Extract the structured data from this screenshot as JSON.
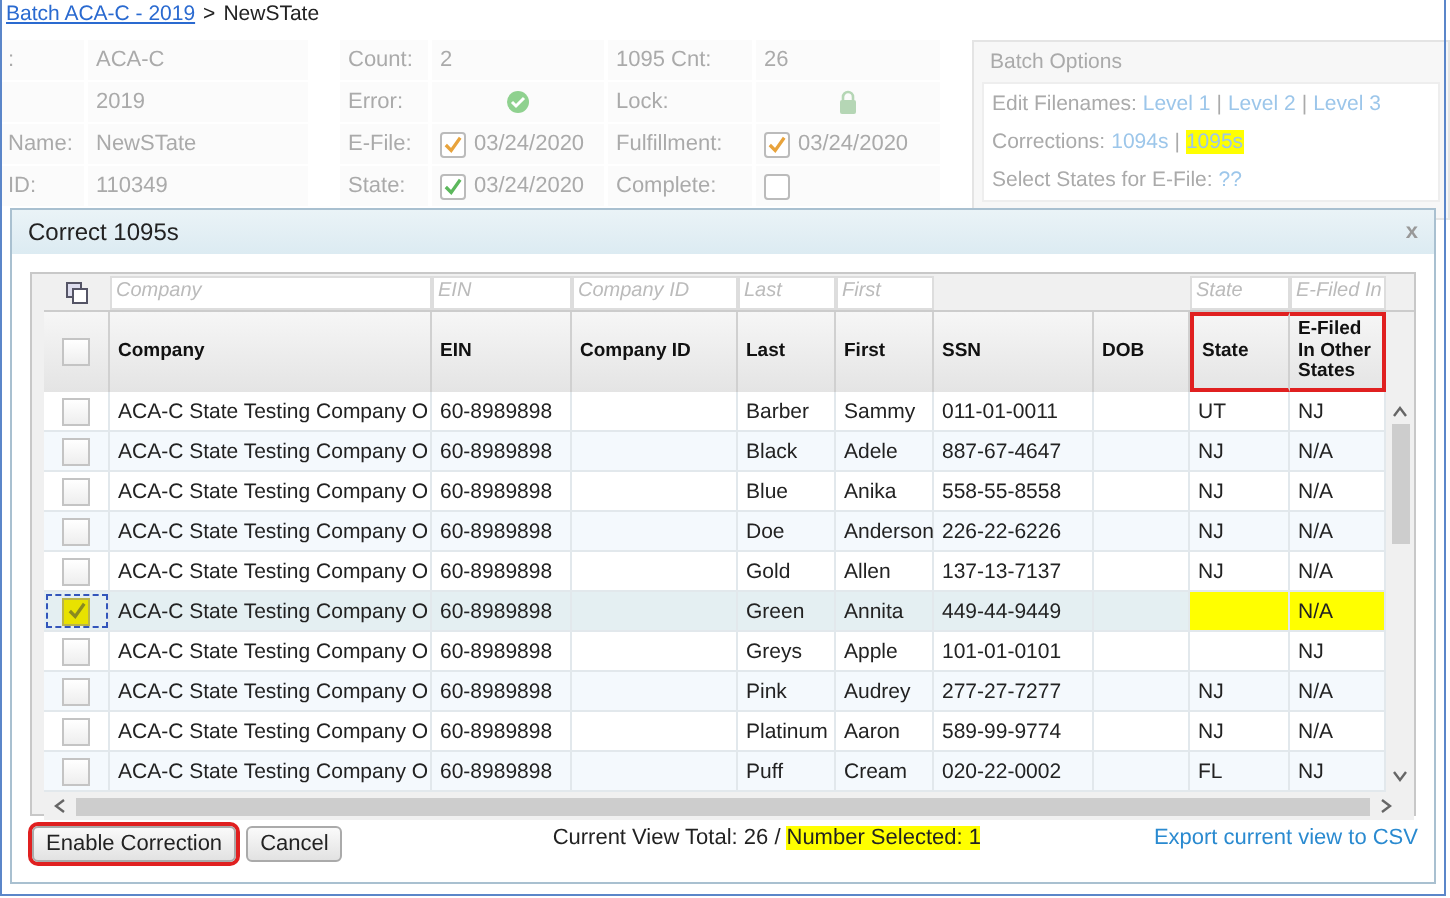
{
  "breadcrumb": {
    "link": "Batch ACA-C - 2019",
    "separator": ">",
    "current": "NewSTate"
  },
  "batch_info": {
    "fields": [
      {
        "label": ":",
        "value": "ACA-C"
      },
      {
        "value": "2019"
      },
      {
        "label": "Name:",
        "value": "NewSTate"
      },
      {
        "label": "ID:",
        "value": "110349"
      }
    ],
    "status": [
      {
        "label": "Count:",
        "kind": "text",
        "value": "2"
      },
      {
        "label": "1095 Cnt:",
        "kind": "text",
        "value": "26"
      },
      {
        "label": "Error:",
        "kind": "ok"
      },
      {
        "label": "Lock:",
        "kind": "lock"
      },
      {
        "label": "E-File:",
        "kind": "check",
        "checked": true,
        "color": "#e8a33c",
        "value": "03/24/2020"
      },
      {
        "label": "Fulfillment:",
        "kind": "check",
        "checked": true,
        "color": "#e8a33c",
        "value": "03/24/2020"
      },
      {
        "label": "State:",
        "kind": "check",
        "checked": true,
        "color": "#5cb85c",
        "value": "03/24/2020"
      },
      {
        "label": "Complete:",
        "kind": "check",
        "checked": false
      }
    ]
  },
  "batch_options": {
    "title": "Batch Options",
    "lines": [
      {
        "label": "Edit Filenames:",
        "separator": "|",
        "links": [
          {
            "text": "Level 1",
            "highlighted": false
          },
          {
            "text": "Level 2",
            "highlighted": false
          },
          {
            "text": "Level 3",
            "highlighted": false
          }
        ]
      },
      {
        "label": "Corrections:",
        "separator": "|",
        "links": [
          {
            "text": "1094s",
            "highlighted": false
          },
          {
            "text": "1095s",
            "highlighted": true
          }
        ]
      },
      {
        "label": "Select States for E-File:",
        "links": [
          {
            "text": "??",
            "highlighted": false
          }
        ]
      }
    ]
  },
  "dialog": {
    "title": "Correct 1095s",
    "close": "x",
    "table": {
      "select_all": {
        "checked": false
      },
      "columns": [
        {
          "label": "Company",
          "filter": "Company",
          "outlined": false
        },
        {
          "label": "EIN",
          "filter": "EIN",
          "outlined": false
        },
        {
          "label": "Company ID",
          "filter": "Company ID",
          "outlined": false
        },
        {
          "label": "Last",
          "filter": "Last",
          "outlined": false
        },
        {
          "label": "First",
          "filter": "First",
          "outlined": false
        },
        {
          "label": "SSN",
          "outlined": false
        },
        {
          "label": "DOB",
          "outlined": false
        },
        {
          "label": "State",
          "filter": "State",
          "outlined": true
        },
        {
          "label": "E-Filed In Other States",
          "filter": "E-Filed In",
          "outlined": true
        }
      ],
      "rows": [
        {
          "selected": false,
          "highlighted": false,
          "cells": [
            "ACA-C State Testing Company O",
            "60-8989898",
            "",
            "Barber",
            "Sammy",
            "011-01-0011",
            "",
            "UT",
            "NJ"
          ]
        },
        {
          "selected": false,
          "highlighted": false,
          "cells": [
            "ACA-C State Testing Company O",
            "60-8989898",
            "",
            "Black",
            "Adele",
            "887-67-4647",
            "",
            "NJ",
            "N/A"
          ]
        },
        {
          "selected": false,
          "highlighted": false,
          "cells": [
            "ACA-C State Testing Company O",
            "60-8989898",
            "",
            "Blue",
            "Anika",
            "558-55-8558",
            "",
            "NJ",
            "N/A"
          ]
        },
        {
          "selected": false,
          "highlighted": false,
          "cells": [
            "ACA-C State Testing Company O",
            "60-8989898",
            "",
            "Doe",
            "Anderson",
            "226-22-6226",
            "",
            "NJ",
            "N/A"
          ]
        },
        {
          "selected": false,
          "highlighted": false,
          "cells": [
            "ACA-C State Testing Company O",
            "60-8989898",
            "",
            "Gold",
            "Allen",
            "137-13-7137",
            "",
            "NJ",
            "N/A"
          ]
        },
        {
          "selected": true,
          "highlighted": true,
          "cells": [
            "ACA-C State Testing Company O",
            "60-8989898",
            "",
            "Green",
            "Annita",
            "449-44-9449",
            "",
            "",
            "N/A"
          ]
        },
        {
          "selected": false,
          "highlighted": false,
          "cells": [
            "ACA-C State Testing Company O",
            "60-8989898",
            "",
            "Greys",
            "Apple",
            "101-01-0101",
            "",
            "",
            "NJ"
          ]
        },
        {
          "selected": false,
          "highlighted": false,
          "cells": [
            "ACA-C State Testing Company O",
            "60-8989898",
            "",
            "Pink",
            "Audrey",
            "277-27-7277",
            "",
            "NJ",
            "N/A"
          ]
        },
        {
          "selected": false,
          "highlighted": false,
          "cells": [
            "ACA-C State Testing Company O",
            "60-8989898",
            "",
            "Platinum",
            "Aaron",
            "589-99-9774",
            "",
            "NJ",
            "N/A"
          ]
        },
        {
          "selected": false,
          "highlighted": false,
          "cells": [
            "ACA-C State Testing Company O",
            "60-8989898",
            "",
            "Puff",
            "Cream",
            "020-22-0002",
            "",
            "FL",
            "NJ"
          ]
        }
      ]
    },
    "buttons": [
      {
        "label": "Enable Correction",
        "outlined": true
      },
      {
        "label": "Cancel",
        "outlined": false
      }
    ],
    "summary": {
      "total": "Current View Total: 26 /",
      "selected": "Number Selected: 1",
      "highlighted": true
    },
    "export_link": "Export current view to CSV"
  }
}
